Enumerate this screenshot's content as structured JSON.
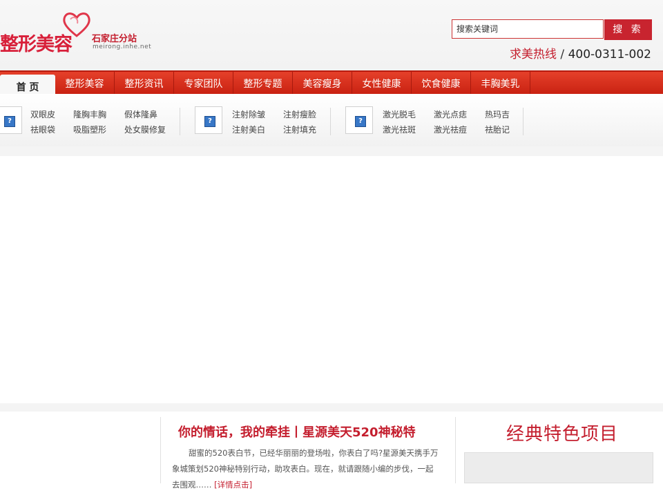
{
  "logo": {
    "main": "整形美容",
    "sub": "石家庄分站",
    "url": "meirong.inhe.net",
    "accent_color": "#d8203a"
  },
  "search": {
    "placeholder": "搜索关键词",
    "button_label": "搜 索"
  },
  "hotline": {
    "label": "求美热线",
    "slash": " / ",
    "number": "400-0311-002"
  },
  "nav": {
    "items": [
      {
        "label": "首 页",
        "active": true
      },
      {
        "label": "整形美容"
      },
      {
        "label": "整形资讯"
      },
      {
        "label": "专家团队"
      },
      {
        "label": "整形专题"
      },
      {
        "label": "美容瘦身"
      },
      {
        "label": "女性健康"
      },
      {
        "label": "饮食健康"
      },
      {
        "label": "丰胸美乳"
      }
    ],
    "color": "#d42e1c"
  },
  "subnav": {
    "group1": {
      "icon": "broken-image-icon",
      "links": [
        "双眼皮",
        "隆胸丰胸",
        "假体隆鼻",
        "祛眼袋",
        "吸脂塑形",
        "处女膜修复"
      ]
    },
    "group2": {
      "icon": "broken-image-icon",
      "links": [
        "注射除皱",
        "注射瘦脸",
        "注射美白",
        "注射填充"
      ]
    },
    "group3": {
      "icon": "broken-image-icon",
      "links": [
        "激光脱毛",
        "激光点痣",
        "热玛吉",
        "激光祛斑",
        "激光祛痘",
        "祛胎记"
      ]
    }
  },
  "article": {
    "title": "你的情话，我的牵挂丨星源美天520神秘特",
    "body_line1": "甜蜜的520表白节，已经华丽丽的登场啦，你表白了吗?星源美天携手万",
    "body_line2": "象城策划520神秘特别行动，助攻表白。现在，就请跟随小编的步伐，一起",
    "body_line3": "去围观……",
    "more": "[详情点击]"
  },
  "side": {
    "title": "经典特色项目"
  }
}
